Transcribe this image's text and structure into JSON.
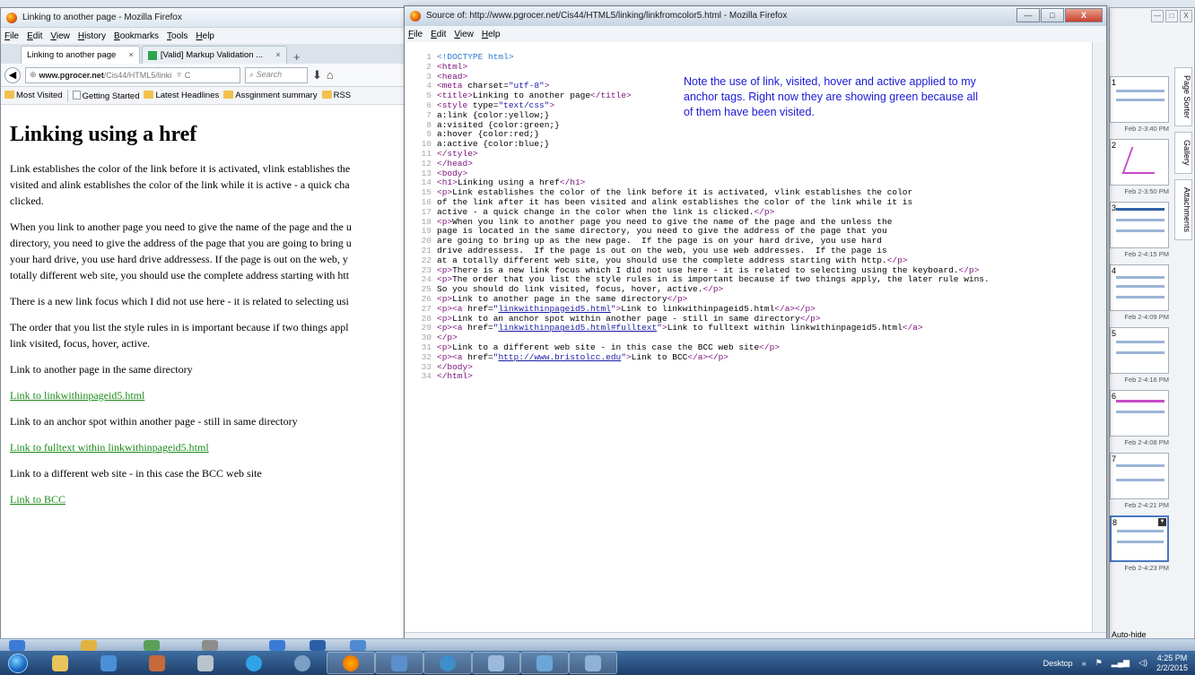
{
  "left_window": {
    "title": "Linking to another page - Mozilla Firefox",
    "menu": [
      "File",
      "Edit",
      "View",
      "History",
      "Bookmarks",
      "Tools",
      "Help"
    ],
    "tabs": [
      {
        "label": "Linking to another page",
        "close": "×"
      },
      {
        "label": "[Valid] Markup Validation ...",
        "close": "×"
      }
    ],
    "new_tab": "+",
    "url_host": "www.pgrocer.net",
    "url_path": "/Cis44/HTML5/linki",
    "search_placeholder": "Search",
    "bookmarks": [
      "Most Visited",
      "Getting Started",
      "Latest Headlines",
      "Assginment summary",
      "RSS"
    ],
    "heading": "Linking using a href",
    "paragraphs": [
      "Link establishes the color of the link before it is activated, vlink establishes the",
      "visited and alink establishes the color of the link while it is active - a quick cha",
      "clicked.",
      "When you link to another page you need to give the name of the page and the u",
      "directory, you need to give the address of the page that you are going to bring u",
      "your hard drive, you use hard drive addressess. If the page is out on the web, y",
      "totally different web site, you should use the complete address starting with htt",
      "There is a new link focus which I did not use here - it is related to selecting usi",
      "The order that you list the style rules in is important because if two things appl",
      "link visited, focus, hover, active."
    ],
    "p_same_dir": "Link to another page in the same directory",
    "link1": "Link to linkwithinpageid5.html",
    "p_anchor": "Link to an anchor spot within another page - still in same directory",
    "link2": "Link to fulltext within linkwithinpageid5.html",
    "p_diff_site": "Link to a different web site - in this case the BCC web site",
    "link3": "Link to BCC"
  },
  "source_window": {
    "title": "Source of: http://www.pgrocer.net/Cis44/HTML5/linking/linkfromcolor5.html - Mozilla Firefox",
    "menu": [
      "File",
      "Edit",
      "View",
      "Help"
    ],
    "controls": {
      "minimize": "—",
      "maximize": "□",
      "close": "X"
    },
    "note": "Note the use of link, visited, hover and active applied to my anchor tags.  Right now they are showing green because all of them have been visited.",
    "lines": [
      [
        {
          "t": "<!DOCTYPE html>",
          "c": "cmt"
        }
      ],
      [
        {
          "t": "<html>",
          "c": "tag"
        }
      ],
      [
        {
          "t": "<head>",
          "c": "tag"
        }
      ],
      [
        {
          "t": "<meta ",
          "c": "tag"
        },
        {
          "t": "charset=",
          "c": "att"
        },
        {
          "t": "\"utf-8\"",
          "c": "attv"
        },
        {
          "t": ">",
          "c": "tag"
        }
      ],
      [
        {
          "t": "<title>",
          "c": "tag"
        },
        {
          "t": "Linking to another page",
          "c": "att"
        },
        {
          "t": "</title>",
          "c": "tag"
        }
      ],
      [
        {
          "t": "<style ",
          "c": "tag"
        },
        {
          "t": "type=",
          "c": "att"
        },
        {
          "t": "\"text/css\"",
          "c": "attv"
        },
        {
          "t": ">",
          "c": "tag"
        }
      ],
      [
        {
          "t": "a:link {color:yellow;}",
          "c": "att"
        }
      ],
      [
        {
          "t": "a:visited {color:green;}",
          "c": "att"
        }
      ],
      [
        {
          "t": "a:hover {color:red;}",
          "c": "att"
        }
      ],
      [
        {
          "t": "a:active {color:blue;}",
          "c": "att"
        }
      ],
      [
        {
          "t": "</style>",
          "c": "tag"
        }
      ],
      [
        {
          "t": "</head>",
          "c": "tag"
        }
      ],
      [
        {
          "t": "<body>",
          "c": "tag"
        }
      ],
      [
        {
          "t": "<h1>",
          "c": "tag"
        },
        {
          "t": "Linking using a href",
          "c": "att"
        },
        {
          "t": "</h1>",
          "c": "tag"
        }
      ],
      [
        {
          "t": "<p>",
          "c": "tag"
        },
        {
          "t": "Link establishes the color of the link before it is activated, vlink establishes the color",
          "c": "att"
        }
      ],
      [
        {
          "t": "of the link after it has been visited and alink establishes the color of the link while it is",
          "c": "att"
        }
      ],
      [
        {
          "t": "active - a quick change in the color when the link is clicked.",
          "c": "att"
        },
        {
          "t": "</p>",
          "c": "tag"
        }
      ],
      [
        {
          "t": "<p>",
          "c": "tag"
        },
        {
          "t": "When you link to another page you need to give the name of the page and the unless the",
          "c": "att"
        }
      ],
      [
        {
          "t": "page is located in the same directory, you need to give the address of the page that you",
          "c": "att"
        }
      ],
      [
        {
          "t": "are going to bring up as the new page.  If the page is on your hard drive, you use hard",
          "c": "att"
        }
      ],
      [
        {
          "t": "drive addressess.  If the page is out on the web, you use web addresses.  If the page is",
          "c": "att"
        }
      ],
      [
        {
          "t": "at a totally different web site, you should use the complete address starting with http.",
          "c": "att"
        },
        {
          "t": "</p>",
          "c": "tag"
        }
      ],
      [
        {
          "t": "<p>",
          "c": "tag"
        },
        {
          "t": "There is a new link focus which I did not use here - it is related to selecting using the keyboard.",
          "c": "att"
        },
        {
          "t": "</p>",
          "c": "tag"
        }
      ],
      [
        {
          "t": "<p>",
          "c": "tag"
        },
        {
          "t": "The order that you list the style rules in is important because if two things apply, the later rule wins.",
          "c": "att"
        }
      ],
      [
        {
          "t": "So you should do link visited, focus, hover, active.",
          "c": "att"
        },
        {
          "t": "</p>",
          "c": "tag"
        }
      ],
      [
        {
          "t": "<p>",
          "c": "tag"
        },
        {
          "t": "Link to another page in the same directory",
          "c": "att"
        },
        {
          "t": "</p>",
          "c": "tag"
        }
      ],
      [
        {
          "t": "<p><a ",
          "c": "tag"
        },
        {
          "t": "href=",
          "c": "att"
        },
        {
          "t": "\"",
          "c": "attv"
        },
        {
          "t": "linkwithinpageid5.html",
          "c": "lnk"
        },
        {
          "t": "\"",
          "c": "attv"
        },
        {
          "t": ">",
          "c": "tag"
        },
        {
          "t": "Link to linkwithinpageid5.html",
          "c": "att"
        },
        {
          "t": "</a></p>",
          "c": "tag"
        }
      ],
      [
        {
          "t": "<p>",
          "c": "tag"
        },
        {
          "t": "Link to an anchor spot within another page - still in same directory",
          "c": "att"
        },
        {
          "t": "</p>",
          "c": "tag"
        }
      ],
      [
        {
          "t": "<p><a ",
          "c": "tag"
        },
        {
          "t": "href=",
          "c": "att"
        },
        {
          "t": "\"",
          "c": "attv"
        },
        {
          "t": "linkwithinpageid5.html#fulltext",
          "c": "lnk"
        },
        {
          "t": "\"",
          "c": "attv"
        },
        {
          "t": ">",
          "c": "tag"
        },
        {
          "t": "Link to fulltext within linkwithinpageid5.html",
          "c": "att"
        },
        {
          "t": "</a>",
          "c": "tag"
        }
      ],
      [
        {
          "t": "</p>",
          "c": "tag"
        }
      ],
      [
        {
          "t": "<p>",
          "c": "tag"
        },
        {
          "t": "Link to a different web site - in this case the BCC web site",
          "c": "att"
        },
        {
          "t": "</p>",
          "c": "tag"
        }
      ],
      [
        {
          "t": "<p><a ",
          "c": "tag"
        },
        {
          "t": "href=",
          "c": "att"
        },
        {
          "t": "\"",
          "c": "attv"
        },
        {
          "t": "http://www.bristolcc.edu",
          "c": "lnk"
        },
        {
          "t": "\"",
          "c": "attv"
        },
        {
          "t": ">",
          "c": "tag"
        },
        {
          "t": "Link to BCC",
          "c": "att"
        },
        {
          "t": "</a></p>",
          "c": "tag"
        }
      ],
      [
        {
          "t": "</body>",
          "c": "tag"
        }
      ],
      [
        {
          "t": "</html>",
          "c": "tag"
        }
      ]
    ]
  },
  "right_panel": {
    "controls": {
      "minimize": "—",
      "maximize": "□",
      "close": "X"
    },
    "thumbnails": [
      {
        "num": "1",
        "time": "Feb 2-3:40 PM"
      },
      {
        "num": "2",
        "time": "Feb 2-3:50 PM"
      },
      {
        "num": "3",
        "time": "Feb 2-4:15 PM"
      },
      {
        "num": "4",
        "time": "Feb 2-4:09 PM"
      },
      {
        "num": "5",
        "time": "Feb 2-4:16 PM"
      },
      {
        "num": "6",
        "time": "Feb 2-4:08 PM"
      },
      {
        "num": "7",
        "time": "Feb 2-4:21 PM"
      },
      {
        "num": "8",
        "time": "Feb 2-4:23 PM"
      }
    ],
    "vertical_tabs": [
      "Page Sorter",
      "Gallery",
      "Attachments"
    ],
    "autohide": "Auto-hide"
  },
  "taskbar": {
    "desktop_label": "Desktop",
    "time": "4:25 PM",
    "date": "2/2/2015"
  },
  "colors": {
    "visited_link": "#1a8c1a",
    "note_text": "#1a1ad6",
    "taskbar": "#1d3f6a"
  }
}
